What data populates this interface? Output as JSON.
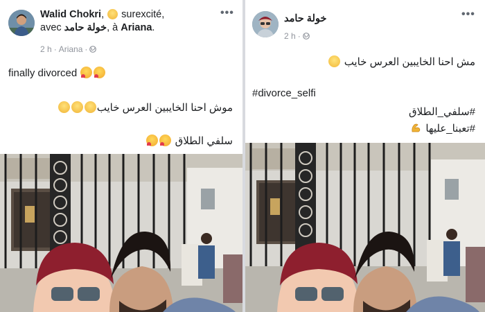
{
  "left_post": {
    "author": "Walid Chokri",
    "feeling": "surexcité,",
    "with_prefix": "avec",
    "with_name": "خولة حامد",
    "location_prefix": ", à",
    "location": "Ariana",
    "location_suffix": ".",
    "time": "2 h",
    "place_meta": "Ariana",
    "line1": "finally divorced",
    "line2": "موش احنا الخايبين العرس خايب",
    "line3": "سلفي الطلاق",
    "more": "•••"
  },
  "right_post": {
    "author": "خولة حامد",
    "time": "2 h",
    "line1": "مش احنا الخايبين العرس خايب",
    "line2": "#divorce_selfi",
    "line3": "#سلفي_الطلاق",
    "line4": "#تعبنا_عليها",
    "more": "•••"
  },
  "colors": {
    "text": "#1c1e21",
    "meta": "#90949c",
    "background": "#ffffff",
    "separator": "#d8dadf"
  },
  "icons": [
    "more-options-icon",
    "globe-icon",
    "smiling-emoji-icon",
    "kissing-heart-emoji-icon",
    "grinning-emoji-icon",
    "relieved-emoji-icon",
    "flexed-biceps-emoji-icon"
  ]
}
